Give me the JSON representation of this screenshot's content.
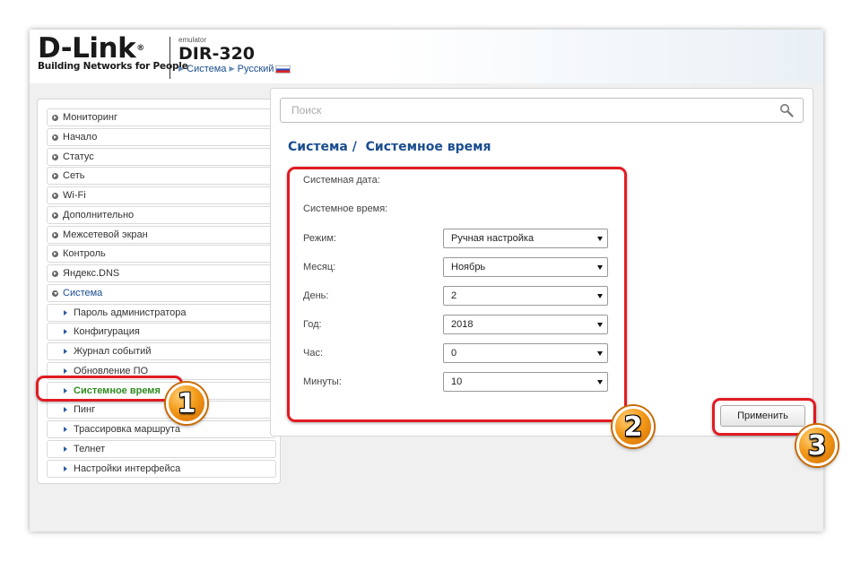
{
  "header": {
    "logo_text": "D-Link",
    "logo_registered": "®",
    "logo_tagline": "Building Networks for People",
    "emulator_label": "emulator",
    "model": "DIR-320",
    "breadcrumb": [
      "Система",
      "Русский"
    ]
  },
  "sidebar": {
    "items": [
      {
        "label": "Мониторинг"
      },
      {
        "label": "Начало"
      },
      {
        "label": "Статус"
      },
      {
        "label": "Сеть"
      },
      {
        "label": "Wi-Fi"
      },
      {
        "label": "Дополнительно"
      },
      {
        "label": "Межсетевой экран"
      },
      {
        "label": "Контроль"
      },
      {
        "label": "Яндекс.DNS"
      },
      {
        "label": "Система",
        "expanded": true
      }
    ],
    "sub_items": [
      {
        "label": "Пароль администратора"
      },
      {
        "label": "Конфигурация"
      },
      {
        "label": "Журнал событий"
      },
      {
        "label": "Обновление ПО"
      },
      {
        "label": "Системное время",
        "active": true
      },
      {
        "label": "Пинг"
      },
      {
        "label": "Трассировка маршрута"
      },
      {
        "label": "Телнет"
      },
      {
        "label": "Настройки интерфейса"
      }
    ]
  },
  "search": {
    "placeholder": "Поиск"
  },
  "page": {
    "section": "Система /",
    "title": "Системное время"
  },
  "form": {
    "system_date_label": "Системная дата:",
    "system_time_label": "Системное время:",
    "fields": [
      {
        "label": "Режим:",
        "value": "Ручная настройка"
      },
      {
        "label": "Месяц:",
        "value": "Ноябрь"
      },
      {
        "label": "День:",
        "value": "2"
      },
      {
        "label": "Год:",
        "value": "2018"
      },
      {
        "label": "Час:",
        "value": "0"
      },
      {
        "label": "Минуты:",
        "value": "10"
      }
    ]
  },
  "apply_label": "Применить",
  "badges": [
    "1",
    "2",
    "3"
  ],
  "colors": {
    "accent": "#1a4d8f",
    "active": "#2e8b1f",
    "highlight": "#e11b22",
    "badge": "#f39a1a"
  }
}
